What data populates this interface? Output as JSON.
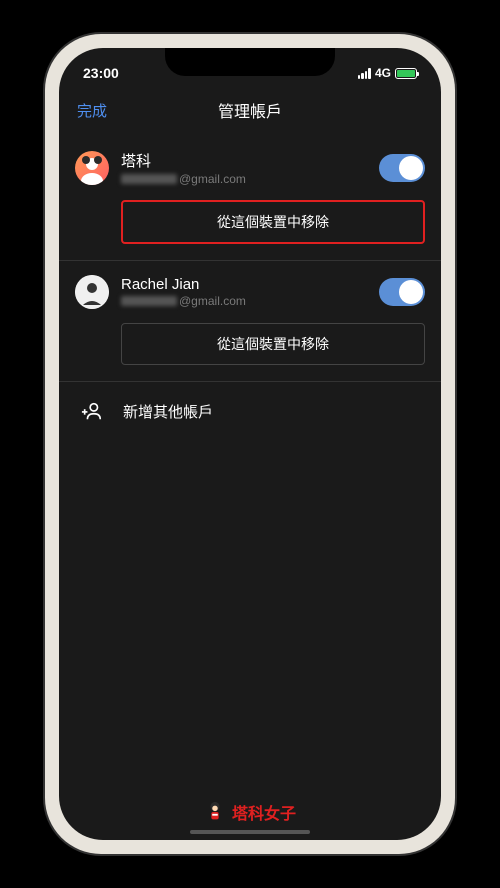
{
  "status": {
    "time": "23:00",
    "network": "4G"
  },
  "nav": {
    "done": "完成",
    "title": "管理帳戶"
  },
  "accounts": [
    {
      "name": "塔科",
      "email_suffix": "@gmail.com",
      "remove_label": "從這個裝置中移除",
      "toggle_on": true,
      "highlighted": true
    },
    {
      "name": "Rachel Jian",
      "email_suffix": "@gmail.com",
      "remove_label": "從這個裝置中移除",
      "toggle_on": true,
      "highlighted": false
    }
  ],
  "add_account": {
    "label": "新增其他帳戶"
  },
  "brand": {
    "label": "塔科女子"
  }
}
